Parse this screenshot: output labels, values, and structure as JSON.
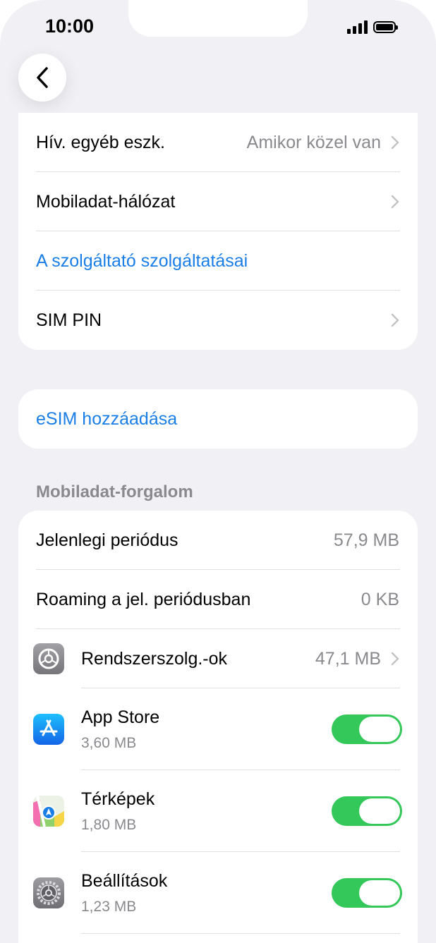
{
  "status": {
    "time": "10:00"
  },
  "carrier_group": {
    "rows": [
      {
        "label": "Hív. egyéb eszk.",
        "value": "Amikor közel van"
      },
      {
        "label": "Mobiladat-hálózat"
      },
      {
        "label": "A szolgáltató szolgáltatásai"
      },
      {
        "label": "SIM PIN"
      }
    ]
  },
  "esim": {
    "label": "eSIM hozzáadása"
  },
  "usage": {
    "header": "Mobiladat-forgalom",
    "current_period": {
      "label": "Jelenlegi periódus",
      "value": "57,9 MB"
    },
    "roaming": {
      "label": "Roaming a jel. periódusban",
      "value": "0 KB"
    },
    "system_services": {
      "label": "Rendszerszolg.-ok",
      "value": "47,1 MB"
    },
    "apps": [
      {
        "name": "App Store",
        "size": "3,60 MB",
        "enabled": true,
        "icon": "app-store-icon"
      },
      {
        "name": "Térképek",
        "size": "1,80 MB",
        "enabled": true,
        "icon": "maps-icon"
      },
      {
        "name": "Beállítások",
        "size": "1,23 MB",
        "enabled": true,
        "icon": "settings-icon"
      }
    ]
  },
  "colors": {
    "accent": "#1a7ee6",
    "toggle_on": "#34c759",
    "background": "#f1f1f5"
  }
}
